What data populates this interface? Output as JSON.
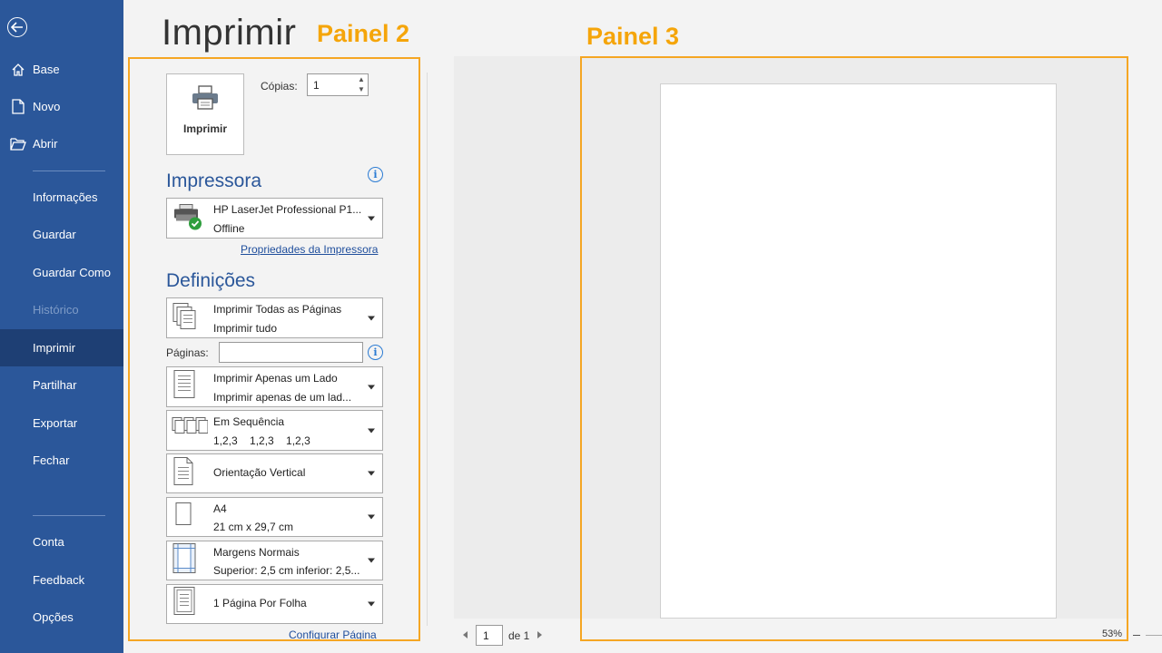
{
  "sidebar": {
    "items": [
      {
        "label": "Base"
      },
      {
        "label": "Novo"
      },
      {
        "label": "Abrir"
      },
      {
        "label": "Informações"
      },
      {
        "label": "Guardar"
      },
      {
        "label": "Guardar Como"
      },
      {
        "label": "Histórico"
      },
      {
        "label": "Imprimir"
      },
      {
        "label": "Partilhar"
      },
      {
        "label": "Exportar"
      },
      {
        "label": "Fechar"
      },
      {
        "label": "Conta"
      },
      {
        "label": "Feedback"
      },
      {
        "label": "Opções"
      }
    ]
  },
  "page_title": "Imprimir",
  "panel_labels": {
    "panel2": "Painel 2",
    "panel3": "Painel 3"
  },
  "print": {
    "button_label": "Imprimir",
    "copies_label": "Cópias:",
    "copies_value": "1"
  },
  "printer": {
    "heading": "Impressora",
    "name": "HP LaserJet Professional P1...",
    "status": "Offline",
    "properties_link": "Propriedades da Impressora"
  },
  "settings": {
    "heading": "Definições",
    "pages_label": "Páginas:",
    "pages_value": "",
    "dropdowns": [
      {
        "line1": "Imprimir Todas as Páginas",
        "line2": "Imprimir tudo"
      },
      {
        "line1": "Imprimir Apenas um Lado",
        "line2": "Imprimir apenas de um lad..."
      },
      {
        "line1": "Em Sequência",
        "line2": "1,2,3    1,2,3    1,2,3"
      },
      {
        "line1": "Orientação Vertical",
        "line2": ""
      },
      {
        "line1": "A4",
        "line2": "21 cm x 29,7 cm"
      },
      {
        "line1": "Margens Normais",
        "line2": "Superior: 2,5 cm inferior: 2,5..."
      },
      {
        "line1": "1 Página Por Folha",
        "line2": ""
      }
    ],
    "page_setup_link": "Configurar Página"
  },
  "preview": {
    "current_page": "1",
    "of_label": "de 1",
    "zoom": "53%"
  },
  "colors": {
    "sidebar": "#2b579a",
    "active": "#1e3f74",
    "accent_orange": "#f5a623",
    "heading_blue": "#2b579a"
  }
}
